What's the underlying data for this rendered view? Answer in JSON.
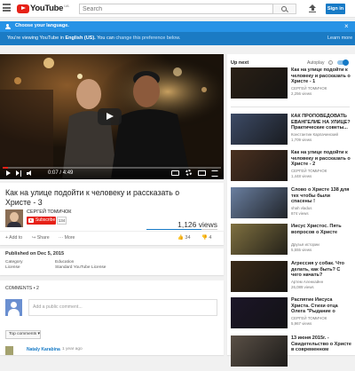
{
  "header": {
    "logo_text": "YouTube",
    "logo_region": "UA",
    "search_placeholder": "Search",
    "signin_label": "Sign in"
  },
  "language_banner": {
    "title": "Choose your language.",
    "message_prefix": "You're viewing YouTube in ",
    "language": "English (US).",
    "message_mid": " You can ",
    "change_link": "change this preference below.",
    "learn_more": "Learn more",
    "close": "×"
  },
  "player": {
    "time_current": "0:07",
    "time_total": "4:49",
    "progress": 0.024
  },
  "video": {
    "title": "Как на улице подойти к человеку и рассказать о Христе - 3",
    "channel": "СЕРГЕЙ ТОМИЧОК",
    "subscribe_label": "Subscribe",
    "subscriber_count": "134",
    "views": "1,126 views",
    "like_ratio": 0.78,
    "actions": {
      "add": "+ Add to",
      "share": "Share",
      "more": "··· More"
    },
    "likes": "34",
    "dislikes": "4",
    "published": "Published on Dec 5, 2015",
    "meta": [
      {
        "key": "Category",
        "value": "Education"
      },
      {
        "key": "License",
        "value": "Standard YouTube License"
      }
    ]
  },
  "comments": {
    "header": "COMMENTS • 2",
    "placeholder": "Add a public comment...",
    "sort_label": "Top comments ▾",
    "first": {
      "author": "Nataly Karabina",
      "time": "1 year ago"
    }
  },
  "sidebar": {
    "up_next": "Up next",
    "autoplay_label": "Autoplay",
    "autoplay_info": "i",
    "items": [
      {
        "title": "Как на улице подойти к человеку и рассказать о Христе - 1",
        "channel": "СЕРГЕЙ ТОМИЧОК",
        "views": "2,256 views",
        "duration": "",
        "theme": "#2a2016"
      },
      {
        "title": "КАК ПРОПОВЕДОВАТЬ ЕВАНГЕЛИЕ НА УЛИЦЕ? Практические советы...",
        "channel": "Константин Карпачинский",
        "views": "1,709 views",
        "duration": "",
        "theme": "#3d4b66"
      },
      {
        "title": "Как на улице подойти к человеку и рассказать о Христе - 2",
        "channel": "СЕРГЕЙ ТОМИЧОК",
        "views": "1,448 views",
        "duration": "",
        "theme": "#4b3120"
      },
      {
        "title": "Слово о Христе 138 для тех чтобы были спасены !",
        "channel": "shah vladus",
        "views": "874 views",
        "duration": "",
        "theme": "#6a7fa0"
      },
      {
        "title": "Иисус Христос. Пять вопросов о Христе",
        "channel": "Друзья истории",
        "views": "5,555 views",
        "duration": "",
        "theme": "#7f7040"
      },
      {
        "title": "Агрессия у собак. Что делать, как быть? С чего начать?",
        "channel": "Артем Аленкайнн",
        "views": "26,089 views",
        "duration": "",
        "theme": "#3a2a18"
      },
      {
        "title": "Распятие Иисуса Христа. Стихи отца Олега \"Рыдание о",
        "channel": "СЕРГЕЙ ТОМИЧОК",
        "views": "5,967 views",
        "duration": "",
        "theme": "#1c1628"
      },
      {
        "title": "13 июня 2015г. - Свидетельство о Христе в современном",
        "channel": "",
        "views": "",
        "duration": "",
        "theme": "#5a5046"
      }
    ]
  }
}
